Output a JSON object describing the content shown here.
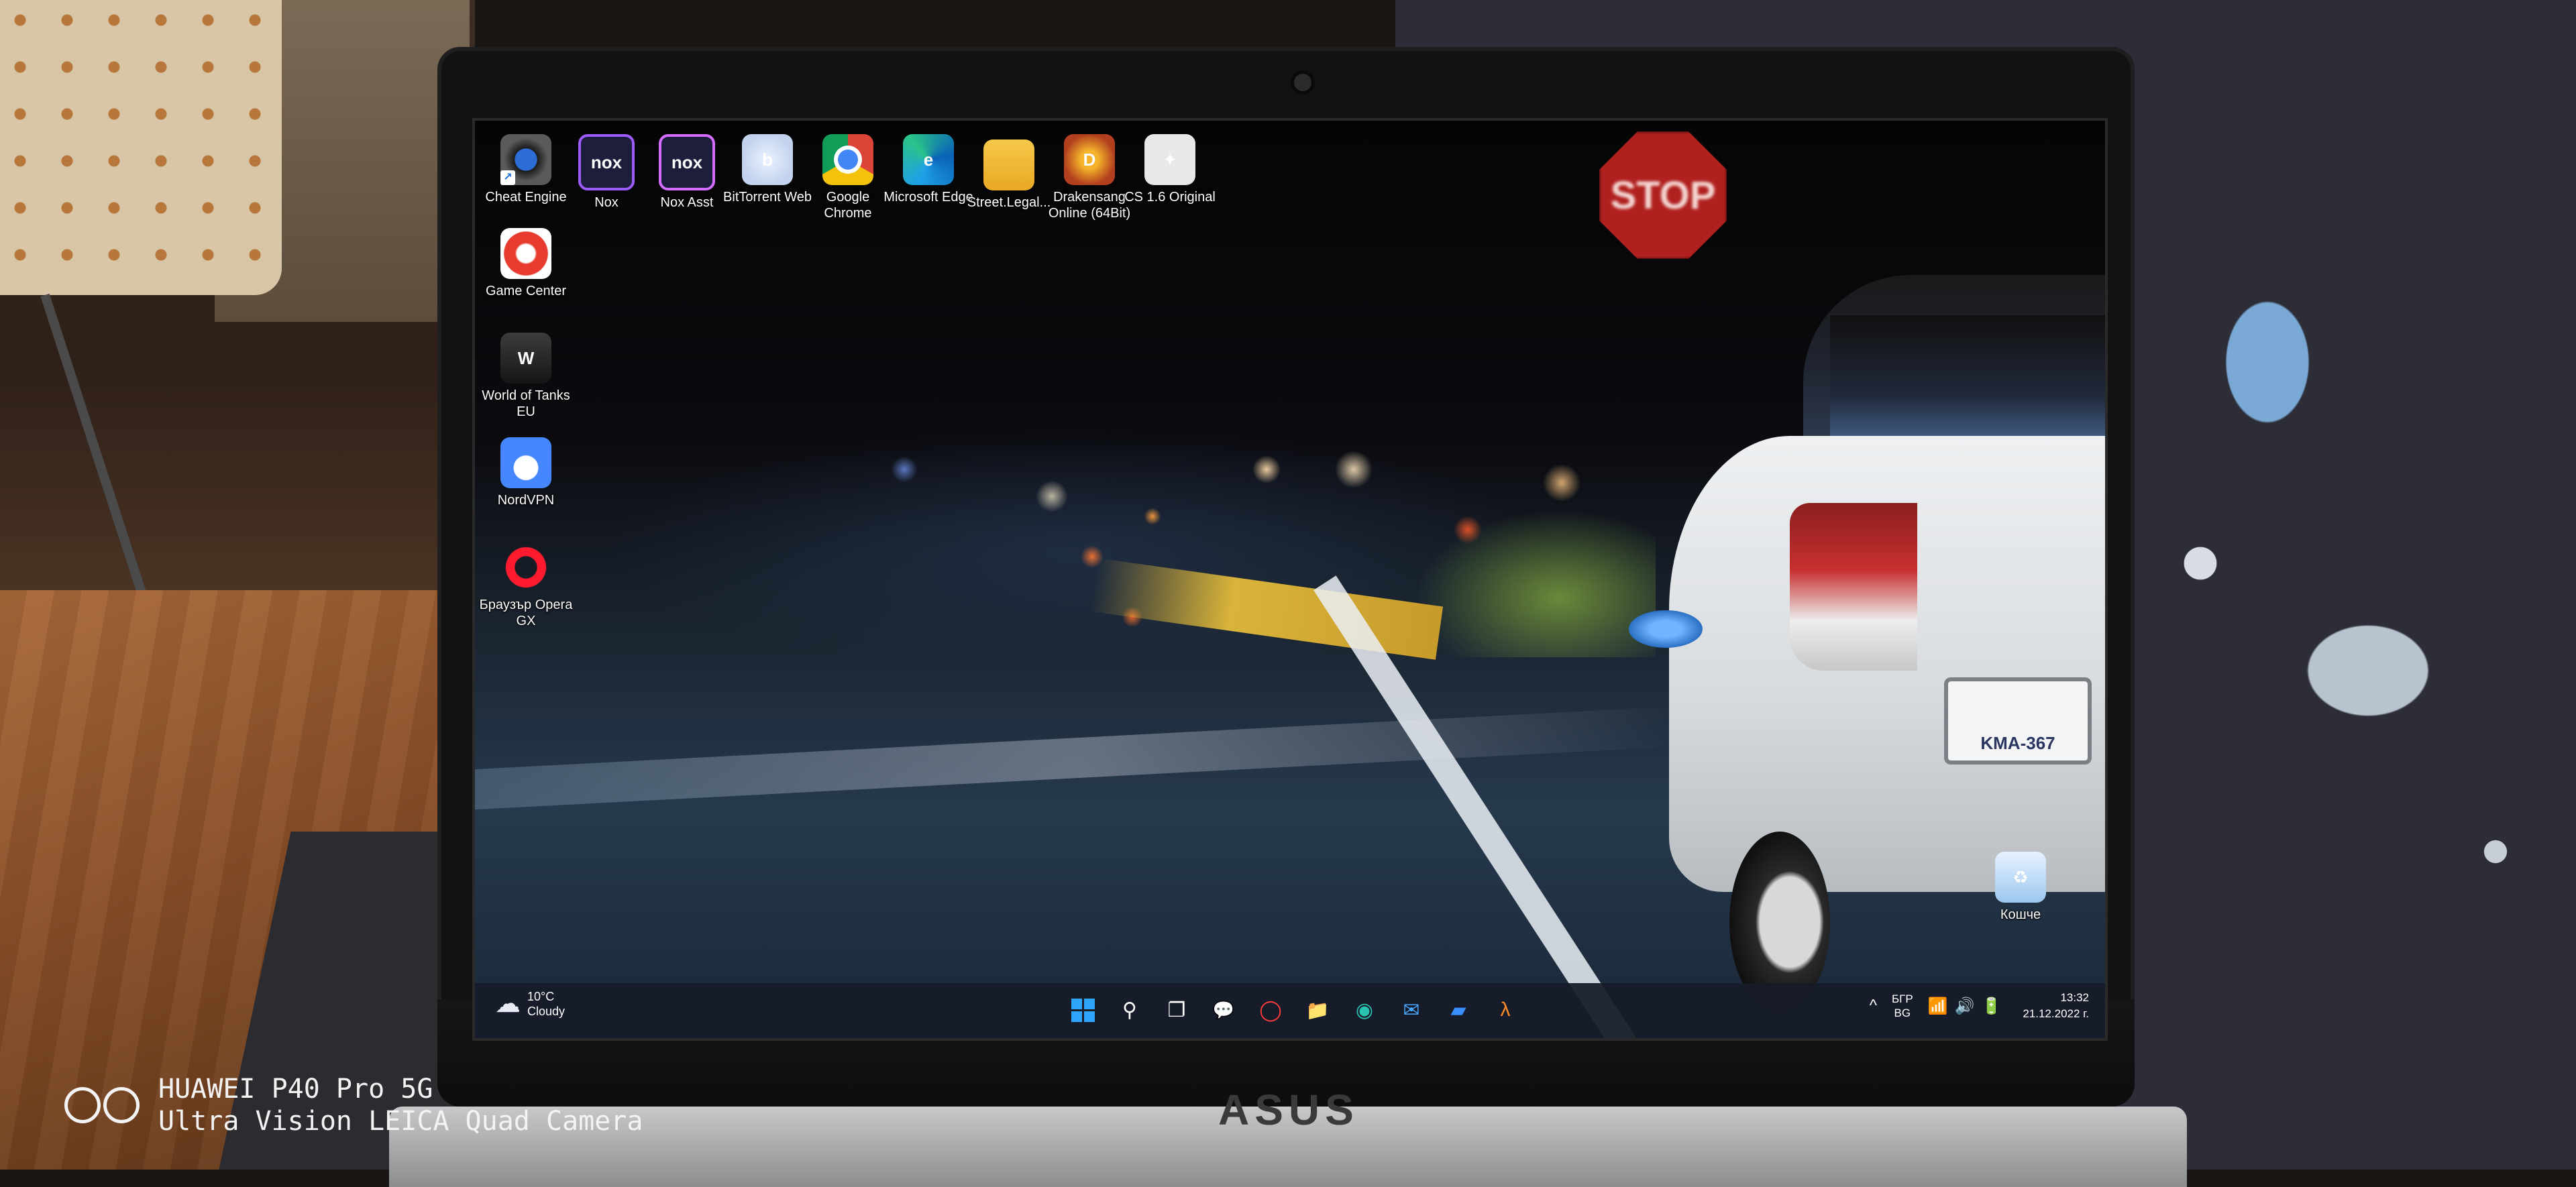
{
  "desktop": {
    "icons": [
      {
        "label": "Cheat Engine",
        "icon": "cheat-engine-icon",
        "glyph": ""
      },
      {
        "label": "Nox",
        "icon": "nox-icon",
        "glyph": "nox"
      },
      {
        "label": "Nox Asst",
        "icon": "nox-assistant-icon",
        "glyph": "nox"
      },
      {
        "label": "BitTorrent Web",
        "icon": "bittorrent-icon",
        "glyph": "b"
      },
      {
        "label": "Google Chrome",
        "icon": "chrome-icon",
        "glyph": ""
      },
      {
        "label": "Microsoft Edge",
        "icon": "edge-icon",
        "glyph": "e"
      },
      {
        "label": "Street.Legal...",
        "icon": "folder-icon",
        "glyph": ""
      },
      {
        "label": "Drakensang Online (64Bit)",
        "icon": "drakensang-icon",
        "glyph": "D"
      },
      {
        "label": "CS 1.6 Original",
        "icon": "cs-icon",
        "glyph": "✦"
      },
      {
        "label": "Game Center",
        "icon": "game-center-icon",
        "glyph": ""
      },
      {
        "label": "World of Tanks EU",
        "icon": "world-of-tanks-icon",
        "glyph": "W"
      },
      {
        "label": "NordVPN",
        "icon": "nordvpn-icon",
        "glyph": "▲"
      },
      {
        "label": "Браузър Opera GX",
        "icon": "opera-gx-icon",
        "glyph": ""
      }
    ],
    "recycle_bin": {
      "label": "Кошче",
      "icon": "recycle-bin-icon",
      "glyph": "♻"
    }
  },
  "wallpaper": {
    "stop_sign": "STOP",
    "plate": "KMA-367"
  },
  "laptop": {
    "brand": "ASUS"
  },
  "taskbar": {
    "weather": {
      "temp": "10°C",
      "condition": "Cloudy"
    },
    "pinned": [
      {
        "name": "start-button",
        "glyph": ""
      },
      {
        "name": "search-icon",
        "glyph": "⚲"
      },
      {
        "name": "task-view-icon",
        "glyph": "❐"
      },
      {
        "name": "chat-icon",
        "glyph": "💬"
      },
      {
        "name": "opera-taskbar-icon",
        "glyph": "◯"
      },
      {
        "name": "file-explorer-icon",
        "glyph": "📁"
      },
      {
        "name": "edge-taskbar-icon",
        "glyph": "◉"
      },
      {
        "name": "mail-icon",
        "glyph": "✉"
      },
      {
        "name": "store-icon",
        "glyph": "▰"
      },
      {
        "name": "app-taskbar-icon",
        "glyph": "λ"
      }
    ],
    "tray": {
      "chevron": "^",
      "lang_line1": "БГР",
      "lang_line2": "BG",
      "sys_icons": "📶🔊🔋",
      "time": "13:32",
      "date": "21.12.2022 г."
    }
  },
  "watermark": {
    "line1": "HUAWEI P40 Pro 5G",
    "line2": "Ultra Vision LEICA Quad Camera"
  },
  "colors": {
    "accent": "#2ea6ff",
    "taskbar": "#161c28"
  }
}
